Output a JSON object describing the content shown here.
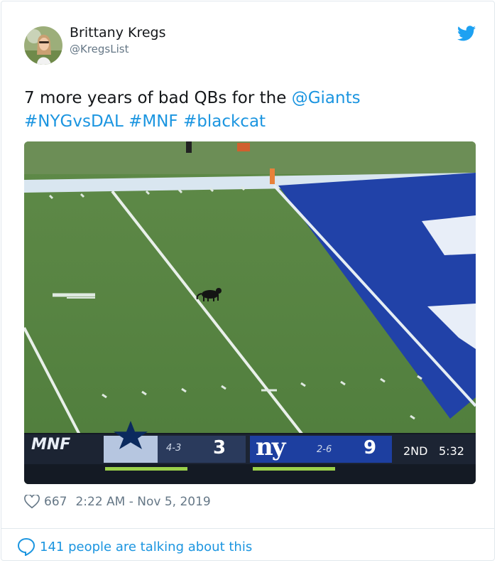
{
  "author": {
    "name": "Brittany Kregs",
    "handle": "@KregsList"
  },
  "icons": {
    "brand": "twitter-bird-icon",
    "like": "heart-icon",
    "conversation": "speech-bubble-icon"
  },
  "colors": {
    "link": "#1b95e0",
    "text": "#14171a",
    "muted": "#657786"
  },
  "tweet": {
    "text_plain": "7 more years of bad QBs for the ",
    "mention": "@Giants",
    "hashtags": [
      "#NYGvsDAL",
      "#MNF",
      "#blackcat"
    ]
  },
  "scorebug": {
    "network": "MNF",
    "away_record": "4-3",
    "away_score": "3",
    "home_abbr": "ny",
    "home_record": "2-6",
    "home_score": "9",
    "period": "2ND",
    "clock": "5:32"
  },
  "meta": {
    "likes": "667",
    "timestamp": "2:22 AM - Nov 5, 2019"
  },
  "footer": {
    "talking": "141 people are talking about this"
  }
}
